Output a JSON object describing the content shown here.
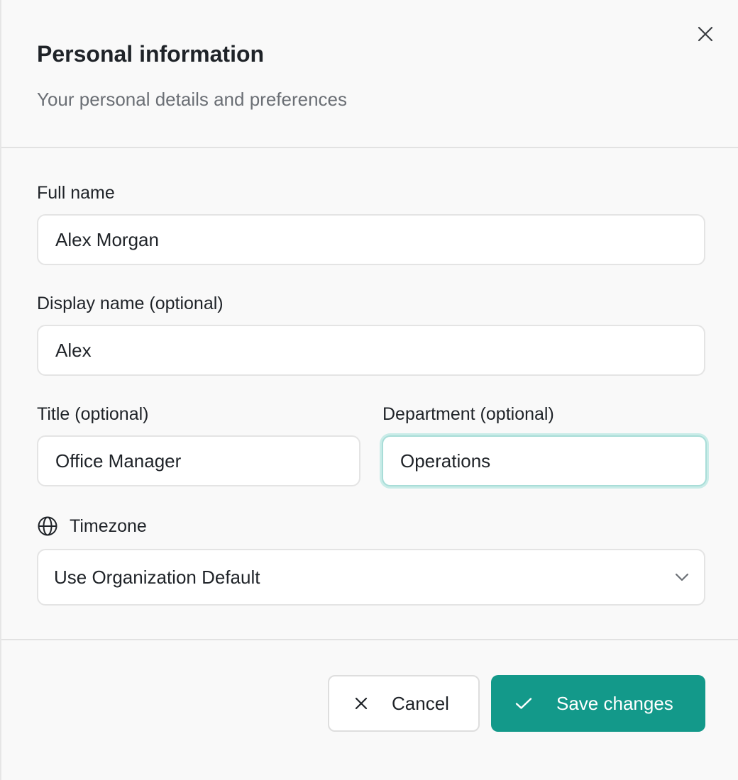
{
  "dialog": {
    "title": "Personal information",
    "subtitle": "Your personal details and preferences",
    "close_icon": "close-icon"
  },
  "fields": {
    "full_name": {
      "label": "Full name",
      "value": "Alex Morgan"
    },
    "display_name": {
      "label": "Display name (optional)",
      "value": "Alex"
    },
    "title": {
      "label": "Title (optional)",
      "value": "Office Manager"
    },
    "department": {
      "label": "Department (optional)",
      "value": "Operations",
      "focused": true
    },
    "timezone": {
      "label": "Timezone",
      "icon": "globe-icon",
      "selected": "Use Organization Default",
      "dropdown_icon": "chevron-down-icon"
    }
  },
  "actions": {
    "cancel_label": "Cancel",
    "cancel_icon": "close-icon",
    "save_label": "Save changes",
    "save_icon": "check-icon"
  },
  "colors": {
    "accent": "#13998a",
    "focus_ring": "#a9ddd8",
    "background": "#f9f9f9",
    "border": "#e4e4e4",
    "text": "#1f2328",
    "muted_text": "#6b6f75"
  }
}
